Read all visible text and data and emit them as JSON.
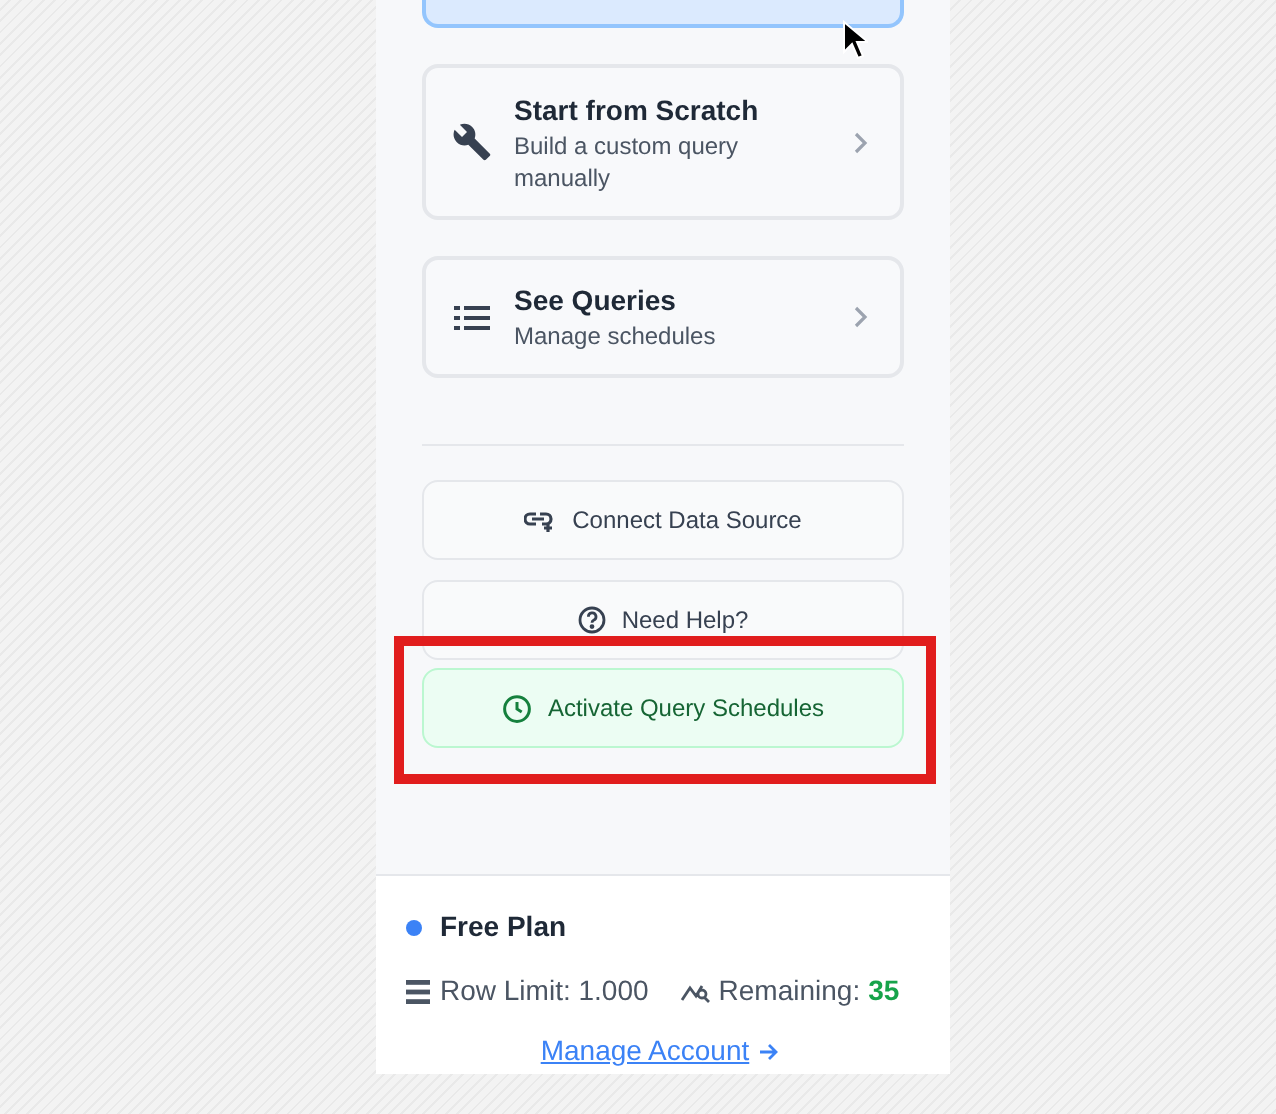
{
  "query_options": [
    {
      "kind": "wrench",
      "title": "Start from Scratch",
      "subtitle": "Build a custom query manually"
    },
    {
      "kind": "list",
      "title": "See Queries",
      "subtitle": "Manage schedules"
    }
  ],
  "actions": [
    {
      "kind": "link",
      "label": "Connect Data Source",
      "highlighted": false
    },
    {
      "kind": "help",
      "label": "Need Help?",
      "highlighted": false
    },
    {
      "kind": "clock",
      "label": "Activate Query Schedules",
      "highlighted": true
    }
  ],
  "plan": {
    "name": "Free Plan",
    "color": "#3b82f6",
    "row_limit": "Row Limit: 1.000",
    "remaining_label": "Remaining:",
    "remaining_value": "35",
    "manage_link": "Manage Account"
  }
}
